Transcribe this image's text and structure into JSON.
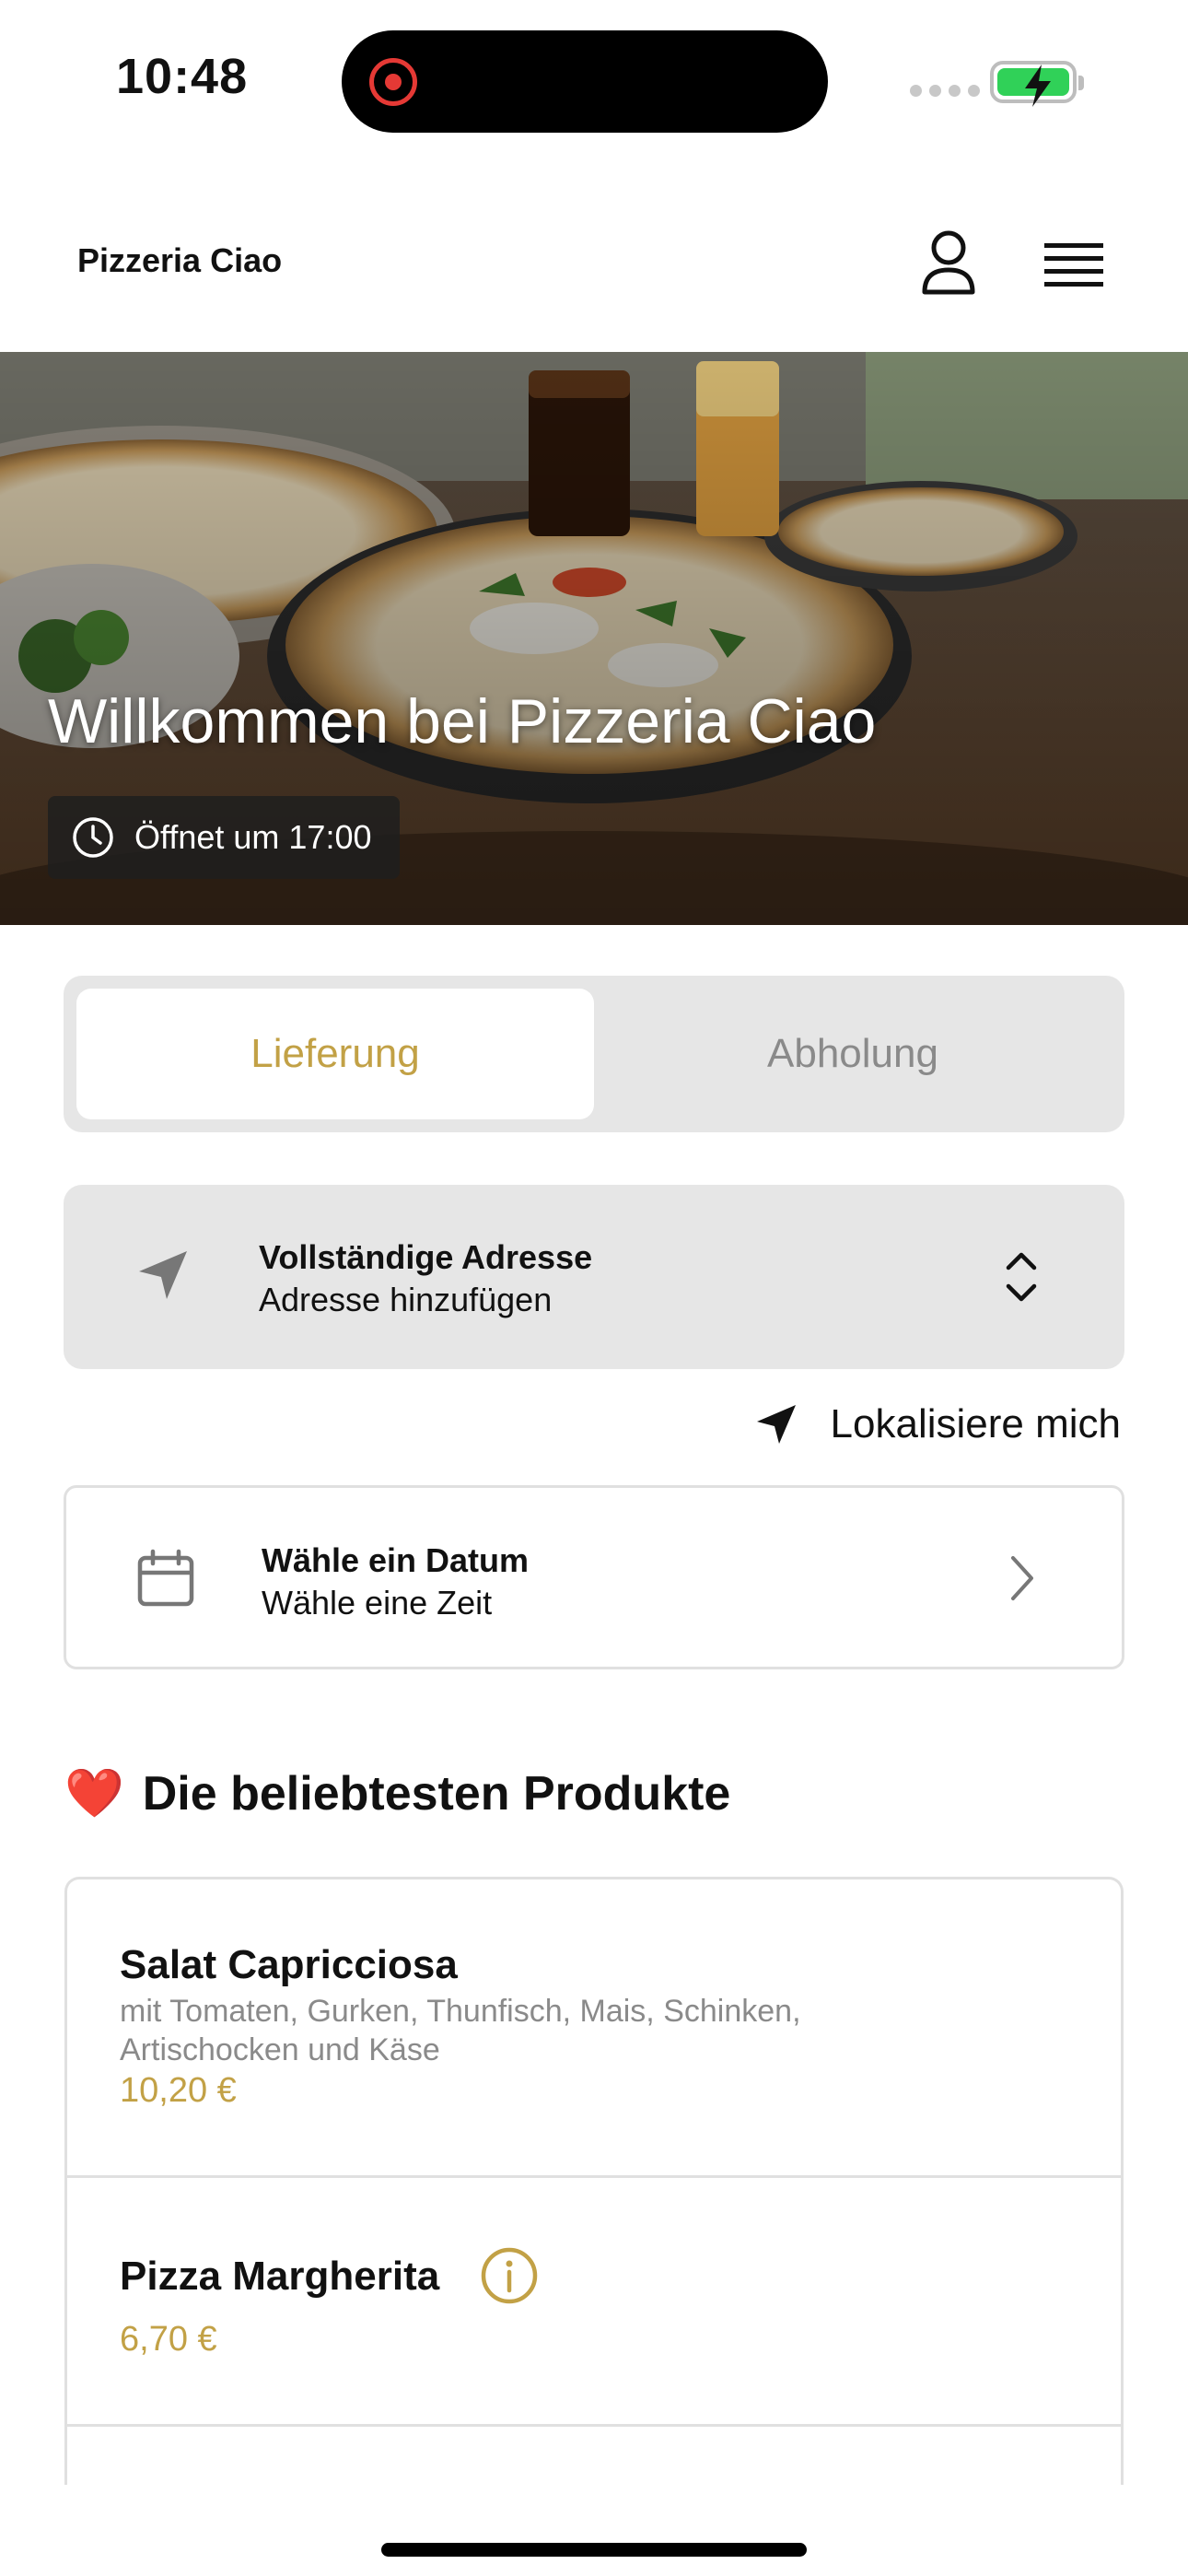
{
  "status_bar": {
    "time": "10:48"
  },
  "header": {
    "brand": "Pizzeria Ciao",
    "user_icon": "person-icon",
    "menu_icon": "hamburger-menu-icon"
  },
  "hero": {
    "title": "Willkommen bei Pizzeria Ciao",
    "open_text": "Öffnet um 17:00",
    "clock_icon": "clock-icon"
  },
  "order_mode": {
    "options": [
      "Lieferung",
      "Abholung"
    ],
    "selected": "Lieferung",
    "accent_color": "#c2a146"
  },
  "address": {
    "title": "Vollständige Adresse",
    "subtitle": "Adresse hinzufügen",
    "icon": "location-arrow-icon"
  },
  "locate_me": {
    "label": "Lokalisiere mich"
  },
  "date_picker": {
    "title": "Wähle ein Datum",
    "subtitle": "Wähle eine Zeit",
    "icon": "calendar-icon"
  },
  "popular": {
    "title": "Die beliebtesten Produkte",
    "emoji": "❤️",
    "products": [
      {
        "name": "Salat Capricciosa",
        "description": "mit Tomaten, Gurken, Thunfisch, Mais, Schinken, Artischocken und Käse",
        "price": "10,20 €"
      },
      {
        "name": "Pizza Margherita",
        "price": "6,70 €"
      }
    ]
  }
}
